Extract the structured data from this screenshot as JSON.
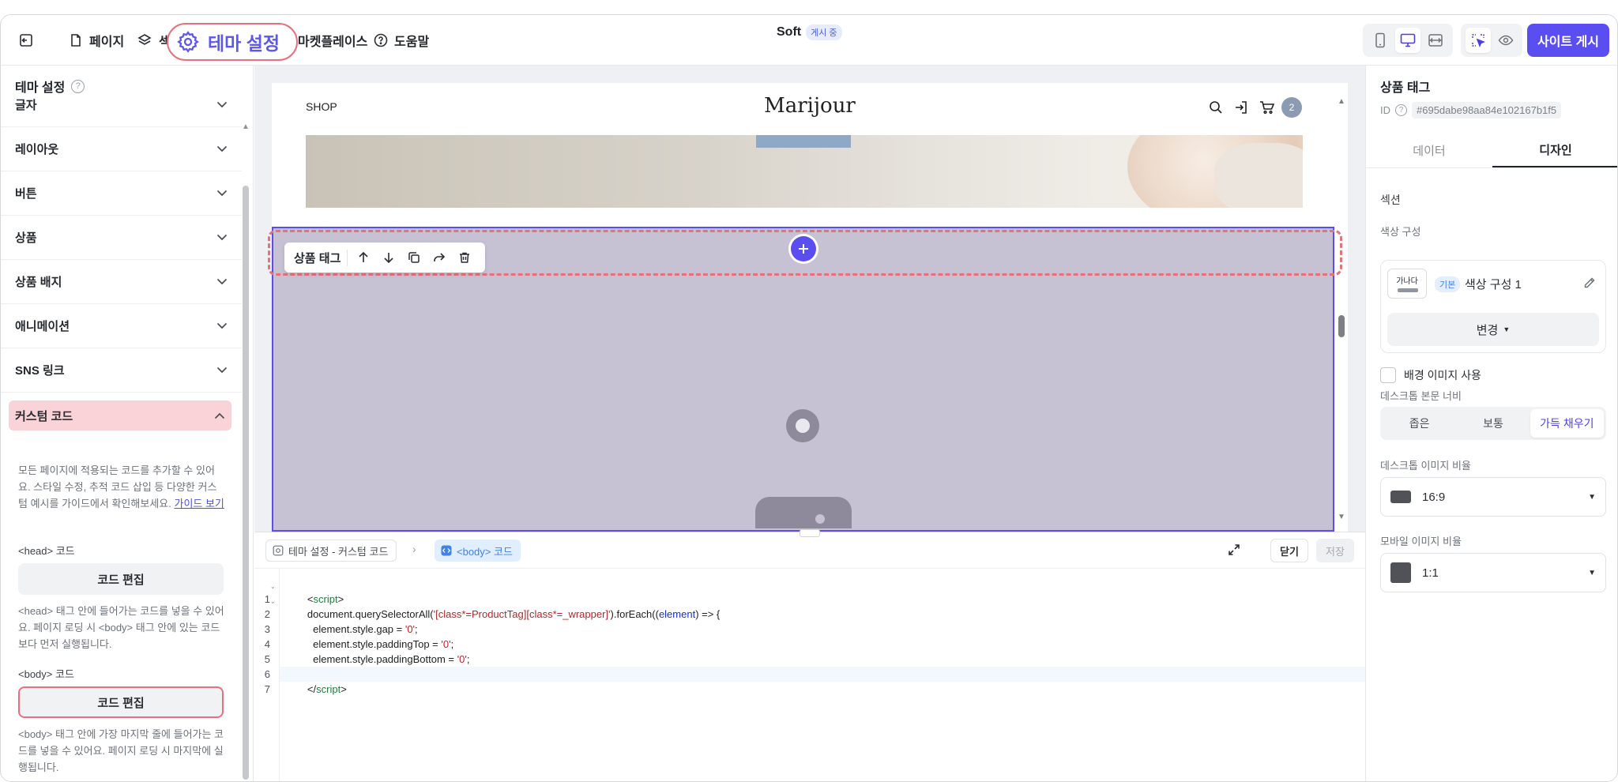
{
  "topbar": {
    "exit_icon": "exit-icon",
    "page_label": "페이지",
    "sections_label_partial": "섹",
    "theme_label": "테마 설정",
    "marketplace_label": "마켓플레이스",
    "help_label": "도움말",
    "site_name": "Soft",
    "site_status": "게시 중",
    "publish_label": "사이트 게시",
    "accent_color": "#5b4ef0"
  },
  "left_panel": {
    "title": "테마 설정",
    "sections": [
      "글자",
      "레이아웃",
      "버튼",
      "상품",
      "상품 배지",
      "애니메이션",
      "SNS 링크"
    ],
    "custom_code": {
      "title": "커스텀 코드",
      "description": "모든 페이지에 적용되는 코드를 추가할 수 있어요. 스타일 수정, 추적 코드 삽입 등 다양한 커스텀 예시를 가이드에서 확인해보세요.",
      "guide_link": "가이드 보기",
      "head_label": "<head> 코드",
      "head_button": "코드 편집",
      "head_desc": "<head> 태그 안에 들어가는 코드를 넣을 수 있어요. 페이지 로딩 시 <body> 태그 안에 있는 코드보다 먼저 실행됩니다.",
      "body_label": "<body> 코드",
      "body_button": "코드 편집",
      "body_desc": "<body> 태그 안에 가장 마지막 줄에 들어가는 코드를 넣을 수 있어요. 페이지 로딩 시 마지막에 실행됩니다."
    }
  },
  "canvas": {
    "site_shop": "SHOP",
    "site_logo": "Marijour",
    "cart_count": "2",
    "toolbar_name": "상품 태그"
  },
  "editor": {
    "crumb_parent": "테마 설정 - 커스텀 코드",
    "crumb_current": "<body> 코드",
    "close_label": "닫기",
    "save_label": "저장",
    "line_numbers": [
      "1",
      "2",
      "3",
      "4",
      "5",
      "6",
      "7"
    ],
    "code": {
      "l1_open": "<",
      "l1_tag": "script",
      "l1_close": ">",
      "l2_pre": "document.querySelectorAll(",
      "l2_str": "'[class*=ProductTag][class*=_wrapper]'",
      "l2_mid": ").forEach((",
      "l2_kw": "element",
      "l2_post": ") => {",
      "l3_pre": "  element.style.gap = ",
      "l3_str": "'0'",
      "l3_post": ";",
      "l4_pre": "  element.style.paddingTop = ",
      "l4_str": "'0'",
      "l4_post": ";",
      "l5_pre": "  element.style.paddingBottom = ",
      "l5_str": "'0'",
      "l5_post": ";",
      "l6": "});",
      "l7_open": "</",
      "l7_tag": "script",
      "l7_close": ">"
    }
  },
  "right_panel": {
    "title": "상품 태그",
    "id_label": "ID",
    "id_value": "#695dabe98aa84e102167b1f5",
    "tabs": [
      "데이터",
      "디자인"
    ],
    "active_tab": "디자인",
    "section_label": "섹션",
    "color_scheme_label": "색상 구성",
    "swatch_text": "가나다",
    "basic_badge": "기본",
    "color_scheme_name": "색상 구성 1",
    "change_label": "변경",
    "bg_image_label": "배경 이미지 사용",
    "desktop_width_label": "데스크톱 본문 너비",
    "width_options": [
      "좁은",
      "보통",
      "가득 채우기"
    ],
    "desktop_ratio_label": "데스크톱 이미지 비율",
    "desktop_ratio_value": "16:9",
    "mobile_ratio_label": "모바일 이미지 비율",
    "mobile_ratio_value": "1:1"
  }
}
